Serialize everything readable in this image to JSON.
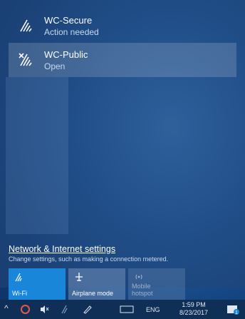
{
  "networks": [
    {
      "ssid": "WC-Secure",
      "status": "Action needed",
      "icon": "wifi-icon"
    },
    {
      "ssid": "WC-Public",
      "status": "Open",
      "icon": "wifi-open-icon"
    }
  ],
  "settings": {
    "link": "Network & Internet settings",
    "subtitle": "Change settings, such as making a connection metered."
  },
  "tiles": {
    "wifi": "Wi-Fi",
    "airplane": "Airplane mode",
    "hotspot": "Mobile hotspot"
  },
  "taskbar": {
    "language": "ENG",
    "time": "1:59 PM",
    "date": "8/23/2017",
    "notification_count": "1"
  },
  "colors": {
    "accent": "#1a86da",
    "taskbar": "#0f2f57"
  }
}
